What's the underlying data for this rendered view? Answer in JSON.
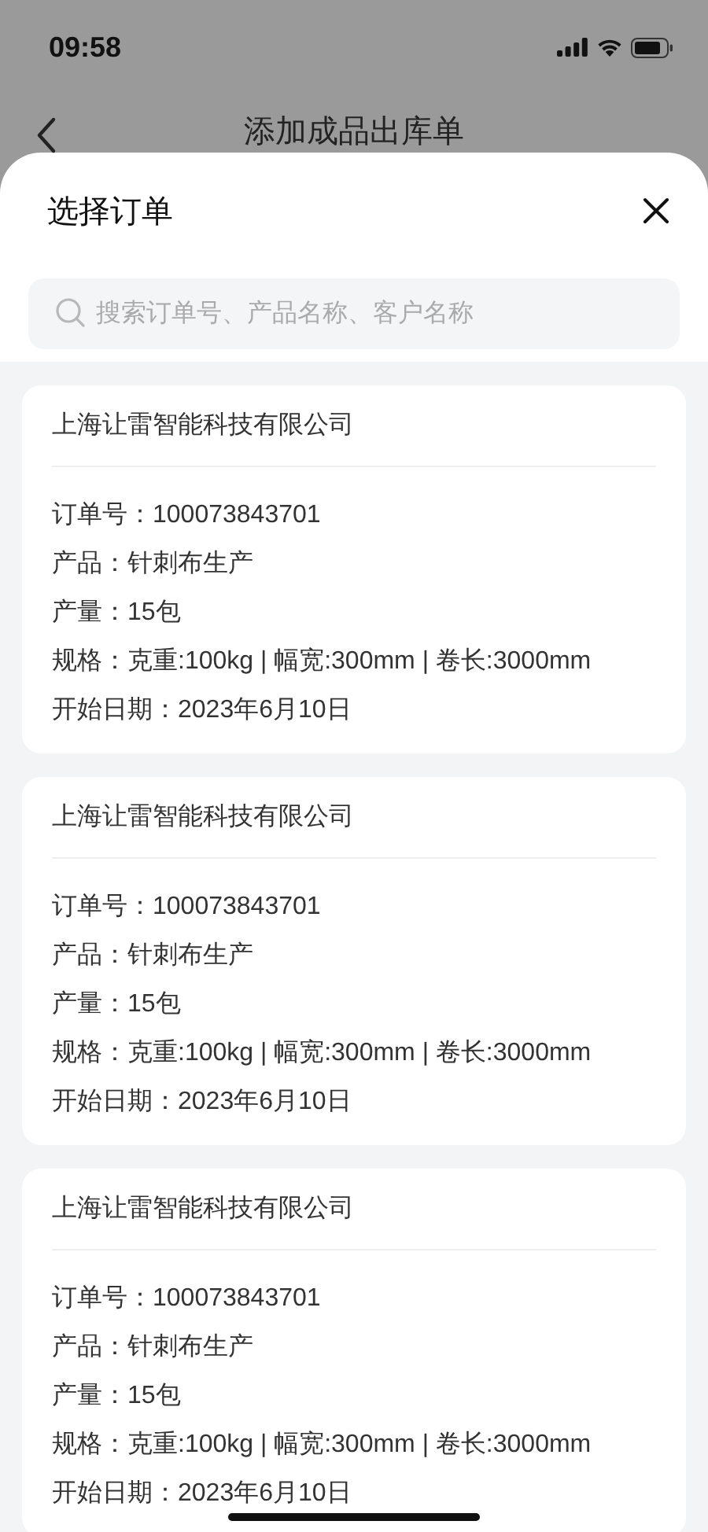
{
  "status_bar": {
    "time": "09:58"
  },
  "nav": {
    "title": "添加成品出库单"
  },
  "sheet": {
    "title": "选择订单",
    "search": {
      "placeholder": "搜索订单号、产品名称、客户名称"
    },
    "orders": [
      {
        "customer": "上海让雷智能科技有限公司",
        "lines": [
          "订单号：100073843701",
          "产品：针刺布生产",
          "产量：15包",
          "规格：克重:100kg | 幅宽:300mm | 卷长:3000mm",
          "开始日期：2023年6月10日"
        ]
      },
      {
        "customer": "上海让雷智能科技有限公司",
        "lines": [
          "订单号：100073843701",
          "产品：针刺布生产",
          "产量：15包",
          "规格：克重:100kg | 幅宽:300mm | 卷长:3000mm",
          "开始日期：2023年6月10日"
        ]
      },
      {
        "customer": "上海让雷智能科技有限公司",
        "lines": [
          "订单号：100073843701",
          "产品：针刺布生产",
          "产量：15包",
          "规格：克重:100kg | 幅宽:300mm | 卷长:3000mm",
          "开始日期：2023年6月10日"
        ]
      }
    ]
  }
}
